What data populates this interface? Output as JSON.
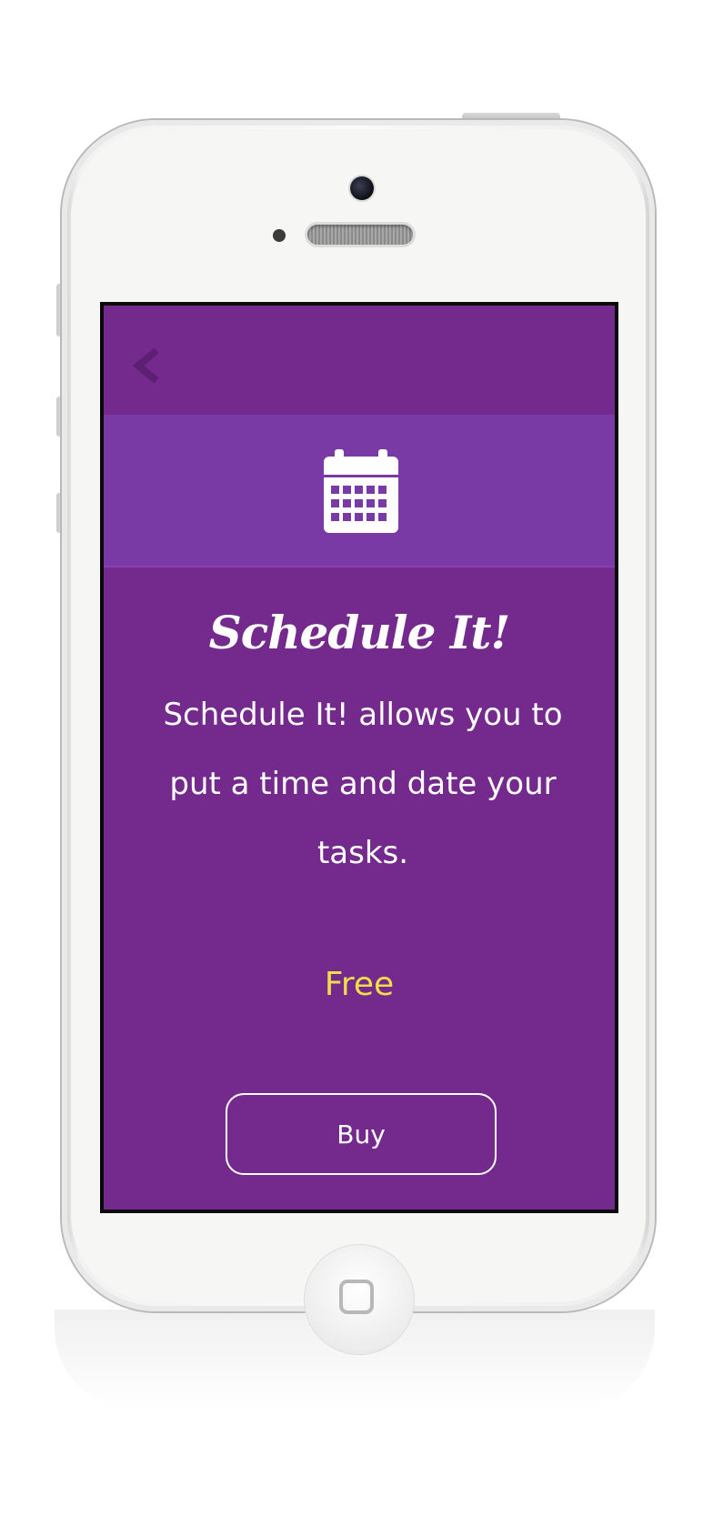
{
  "nav": {
    "back_icon": "chevron-left-icon"
  },
  "hero": {
    "icon": "calendar-icon"
  },
  "app": {
    "title": "Schedule It!",
    "description": "Schedule It! allows you to put a time and date your tasks.",
    "price": "Free",
    "buy_label": "Buy"
  },
  "colors": {
    "background": "#742a8c",
    "icon_band": "#7a3aa5",
    "price": "#f1dd4a",
    "text": "#ffffff",
    "back_icon": "#5d1f73"
  }
}
